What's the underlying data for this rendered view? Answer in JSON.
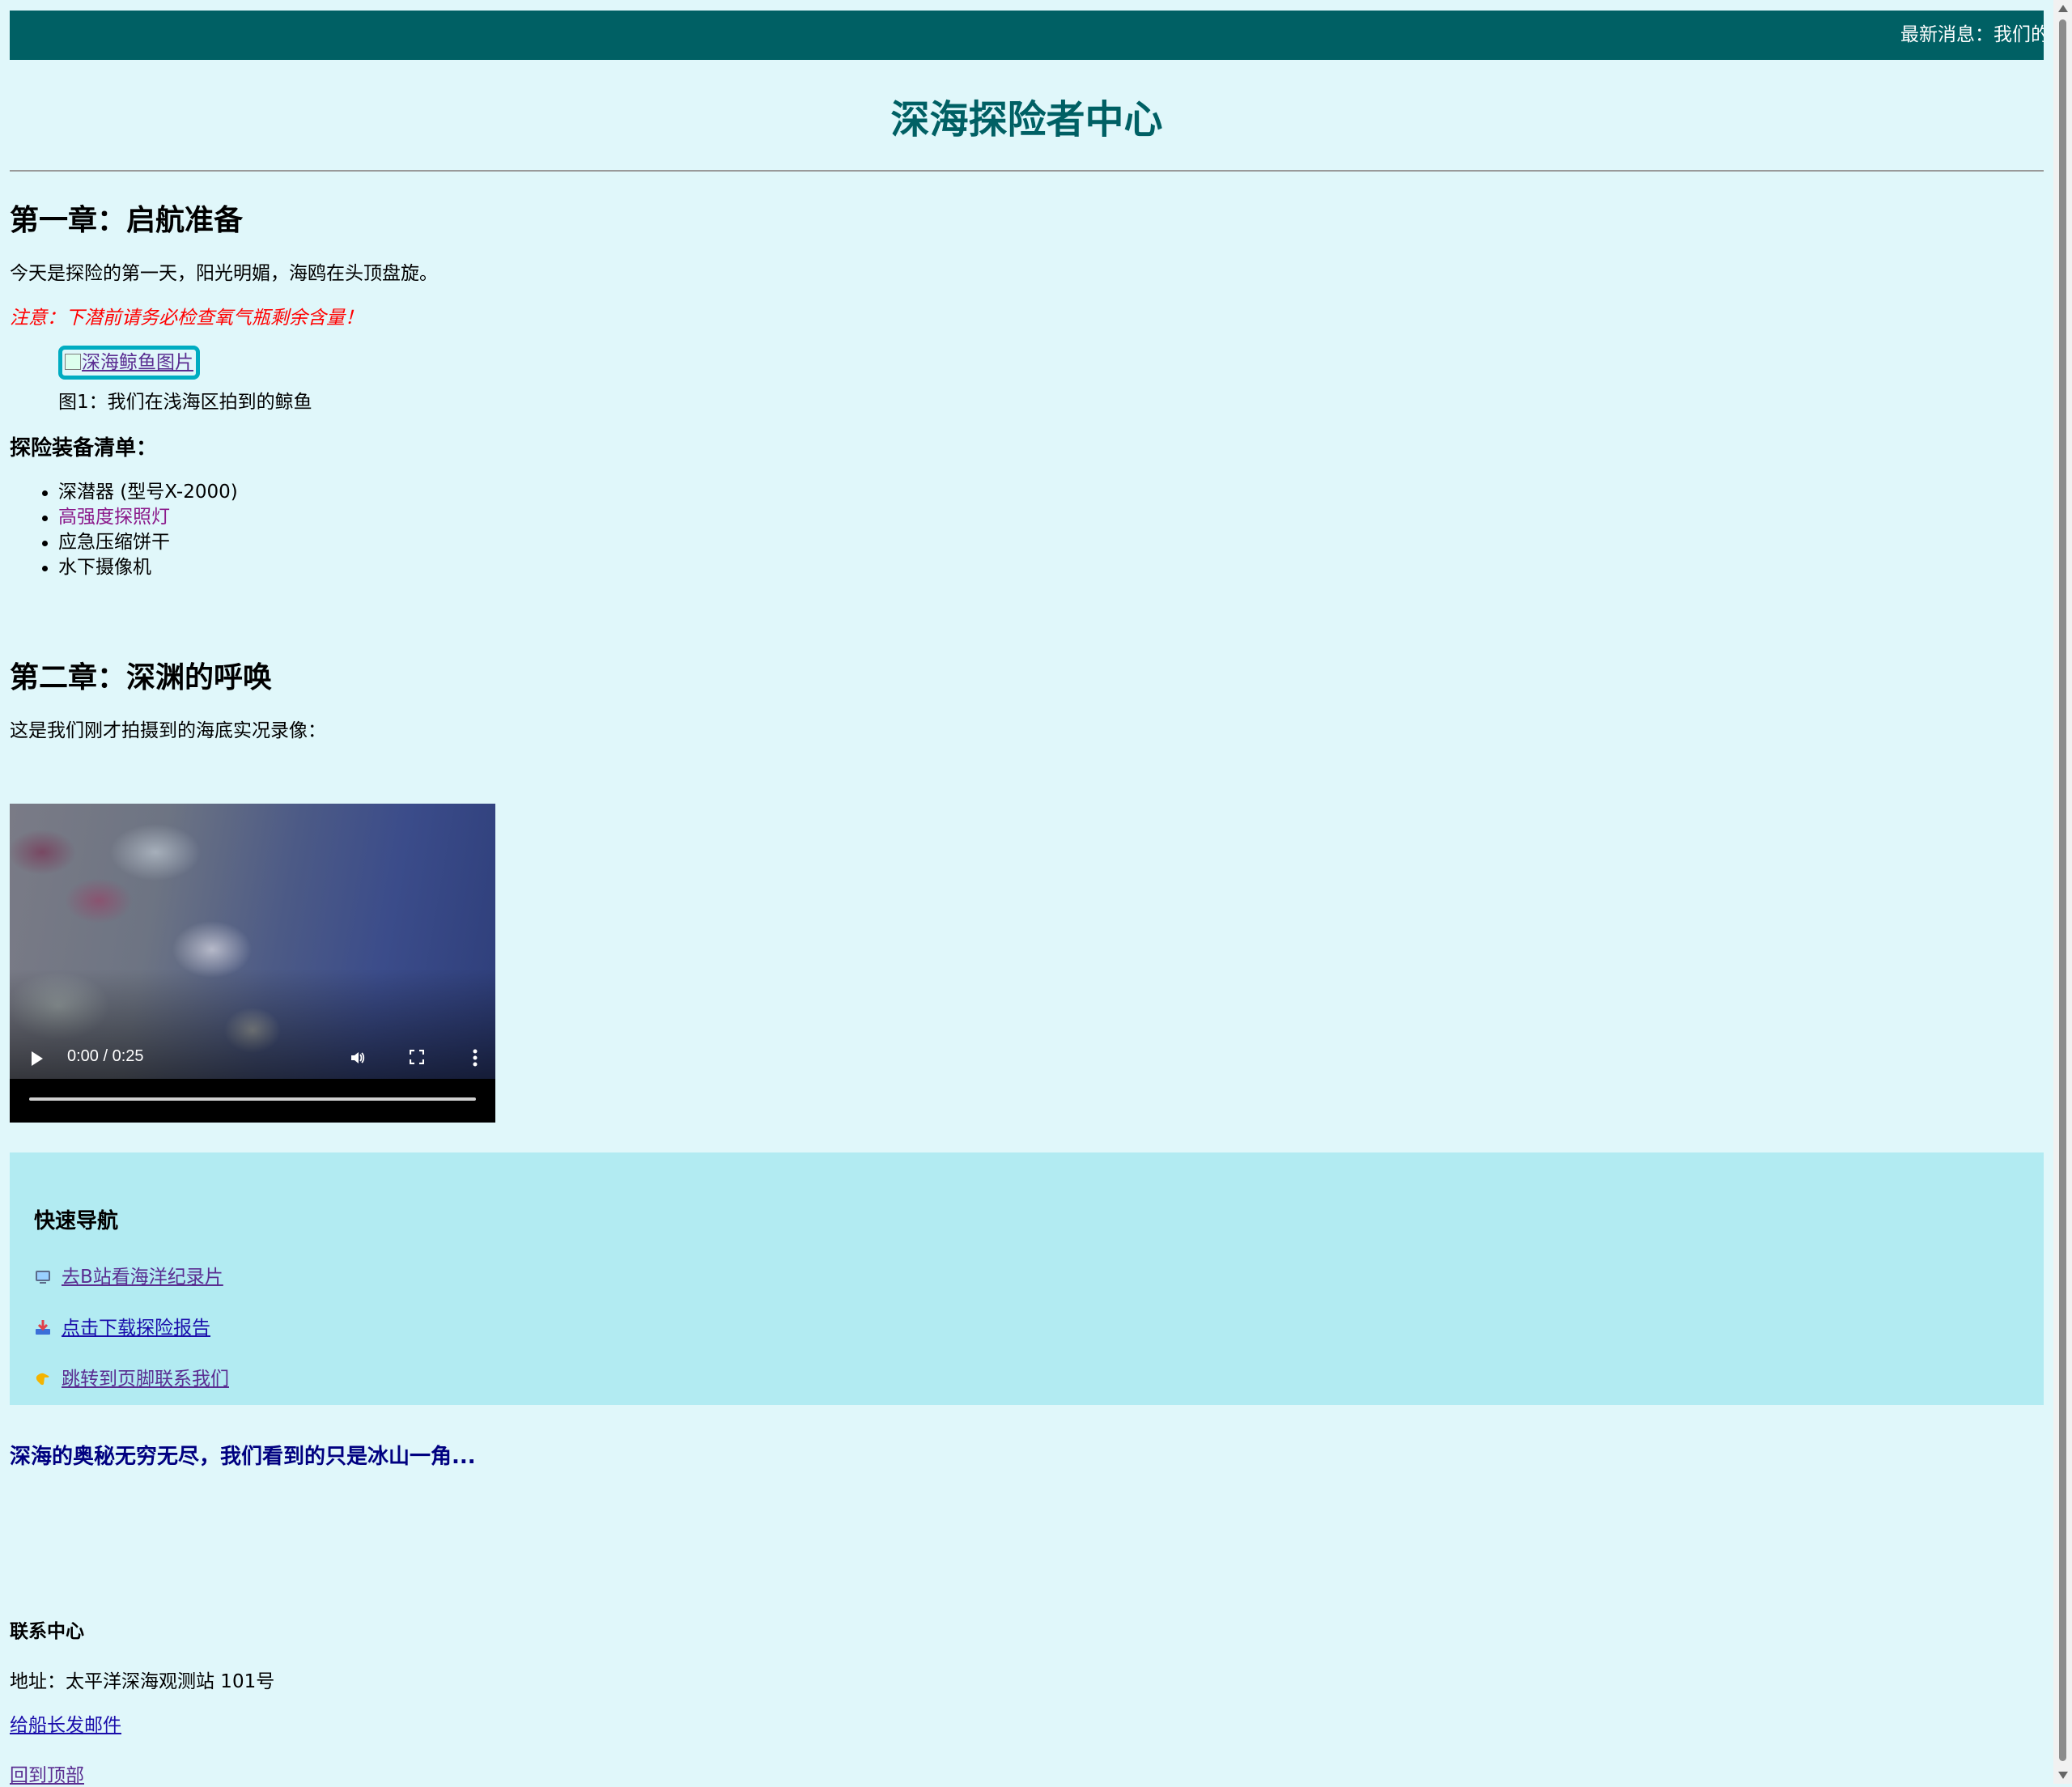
{
  "ticker": {
    "text": "最新消息：我们的"
  },
  "site_title": "深海探险者中心",
  "chapter1": {
    "title": "第一章：启航准备",
    "intro": "今天是探险的第一天，阳光明媚，海鸥在头顶盘旋。",
    "warning": "注意：下潜前请务必检查氧气瓶剩余含量！",
    "image_alt": "深海鲸鱼图片",
    "caption": "图1：我们在浅海区拍到的鲸鱼"
  },
  "equipment": {
    "title": "探险装备清单：",
    "items": [
      "深潜器 (型号X-2000)",
      "高强度探照灯",
      "应急压缩饼干",
      "水下摄像机"
    ]
  },
  "chapter2": {
    "title": "第二章：深渊的呼唤",
    "intro": "这是我们刚才拍摄到的海底实况录像：",
    "video_time": "0:00 / 0:25",
    "video_progress": 0
  },
  "quick_nav": {
    "title": "快速导航",
    "links": [
      {
        "icon": "tv-icon",
        "label": "去B站看海洋纪录片"
      },
      {
        "icon": "download-icon",
        "label": "点击下载探险报告"
      },
      {
        "icon": "pointing-hand-icon",
        "label": "跳转到页脚联系我们"
      }
    ]
  },
  "quote": "深海的奥秘无穷无尽，我们看到的只是冰山一角...",
  "footer": {
    "title": "联系中心",
    "address": "地址：太平洋深海观测站 101号",
    "email_link": "给船长发邮件",
    "top_link": "回到顶部"
  },
  "colors": {
    "background": "#e0f7fa",
    "header": "#006064",
    "nav_box": "#b2ebf2",
    "warning": "#ff0000",
    "quote": "#000080",
    "image_border": "#00acc1"
  }
}
